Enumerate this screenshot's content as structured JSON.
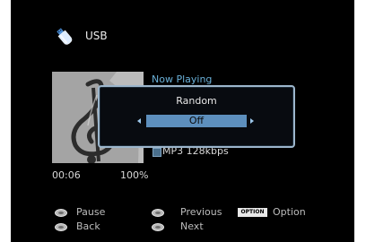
{
  "header": {
    "title": "USB",
    "icon": "usb-icon"
  },
  "now_playing": {
    "label": "Now Playing",
    "codec_icon": "codec-icon",
    "format": "MP3 128kbps",
    "elapsed": "00:06",
    "percent": "100%"
  },
  "popup": {
    "title": "Random",
    "value": "Off",
    "left_arrow_icon": "left-arrow-icon",
    "right_arrow_icon": "right-arrow-icon"
  },
  "footer": {
    "pause": "Pause",
    "back": "Back",
    "previous": "Previous",
    "next": "Next",
    "option_badge": "OPTION",
    "option": "Option"
  },
  "colors": {
    "screen_bg": "#000000",
    "accent": "#5d8fbd",
    "now_playing": "#6ab0d8",
    "popup_border": "#9cb6cc"
  }
}
